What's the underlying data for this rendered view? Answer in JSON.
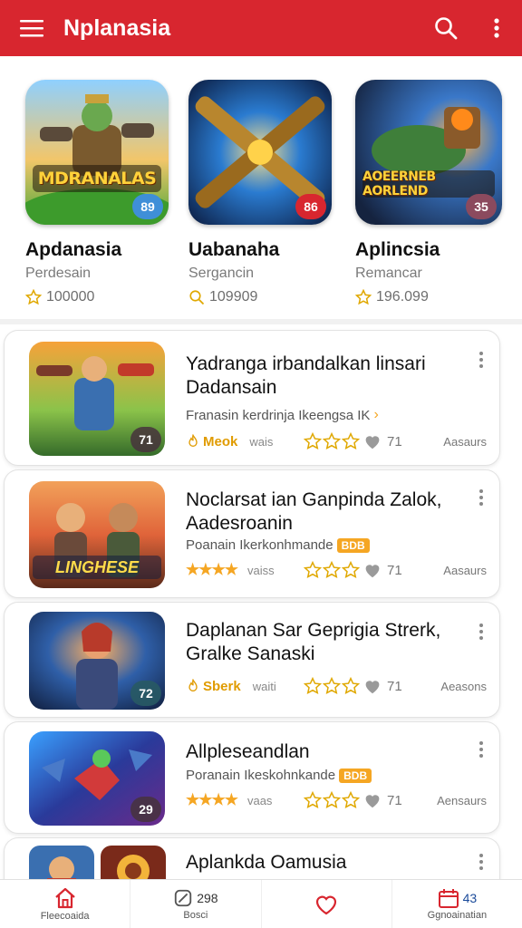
{
  "appbar": {
    "title": "Nplanasia",
    "bg_color": "#d8262f",
    "menu_icon": "hamburger-icon",
    "search_icon": "search-icon",
    "more_icon": "more-vert-icon"
  },
  "featured": [
    {
      "name": "Apdanasia",
      "subtitle": "Perdesain",
      "count": "100000",
      "badge": "89",
      "badge_color": "#3f8fd8",
      "banner": "MDRANALAS",
      "stat_icon": "star-outline-icon"
    },
    {
      "name": "Uabanaha",
      "subtitle": "Sergancin",
      "count": "109909",
      "badge": "86",
      "badge_color": "#d8262f",
      "banner": "",
      "stat_icon": "search-icon"
    },
    {
      "name": "Aplincsia",
      "subtitle": "Remancar",
      "count": "196.099",
      "badge": "35",
      "badge_color": "#8b4a5e",
      "banner": "AOEERNEB AORLEND",
      "stat_icon": "star-outline-icon"
    }
  ],
  "list": [
    {
      "title": "Yadranga irbandalkan linsari Dadansain",
      "subtitle": "Franasin kerdrinja Ikeengsa IK",
      "tag": "",
      "chevron": true,
      "rating_label": "Meok",
      "rating_type": "icon",
      "rating_prefix_text": "wais",
      "likes": "71",
      "category": "Aasaurs",
      "badge": "71",
      "logo": ""
    },
    {
      "title": "Noclarsat ian Ganpinda Zalok, Aadesroanin",
      "subtitle": "Poanain Ikerkonhmande",
      "tag": "BDB",
      "chevron": false,
      "rating_label": "",
      "rating_type": "stars",
      "rating_prefix_text": "vaiss",
      "likes": "71",
      "category": "Aasaurs",
      "badge": "",
      "logo": "LINGHESE"
    },
    {
      "title": "Daplanan Sar Geprigia Strerk, Gralke Sanaski",
      "subtitle": "",
      "tag": "",
      "chevron": false,
      "rating_label": "Sberk",
      "rating_type": "icon",
      "rating_prefix_text": "waiti",
      "likes": "71",
      "category": "Aeasons",
      "badge": "72",
      "logo": ""
    },
    {
      "title": "Allpleseandlan",
      "subtitle": "Poranain Ikeskohnkande",
      "tag": "BDB",
      "chevron": false,
      "rating_label": "",
      "rating_type": "stars",
      "rating_prefix_text": "vaas",
      "likes": "71",
      "category": "Aensaurs",
      "badge": "29",
      "logo": ""
    },
    {
      "title": "Aplankda Oamusia",
      "subtitle": "",
      "tag": "",
      "chevron": false,
      "rating_label": "",
      "rating_type": "none",
      "rating_prefix_text": "",
      "likes": "",
      "category": "",
      "badge": "",
      "logo": ""
    }
  ],
  "bottomnav": [
    {
      "label": "Fleecoaida",
      "icon": "home-icon",
      "count": ""
    },
    {
      "label": "Bosci",
      "icon": "tag-icon",
      "count": "298"
    },
    {
      "label": "",
      "icon": "heart-icon",
      "count": ""
    },
    {
      "label": "Ggnoainatian",
      "icon": "calendar-icon",
      "count": "43"
    }
  ],
  "colors": {
    "accent": "#d8262f",
    "star": "#f5a623",
    "muted": "#777777"
  }
}
